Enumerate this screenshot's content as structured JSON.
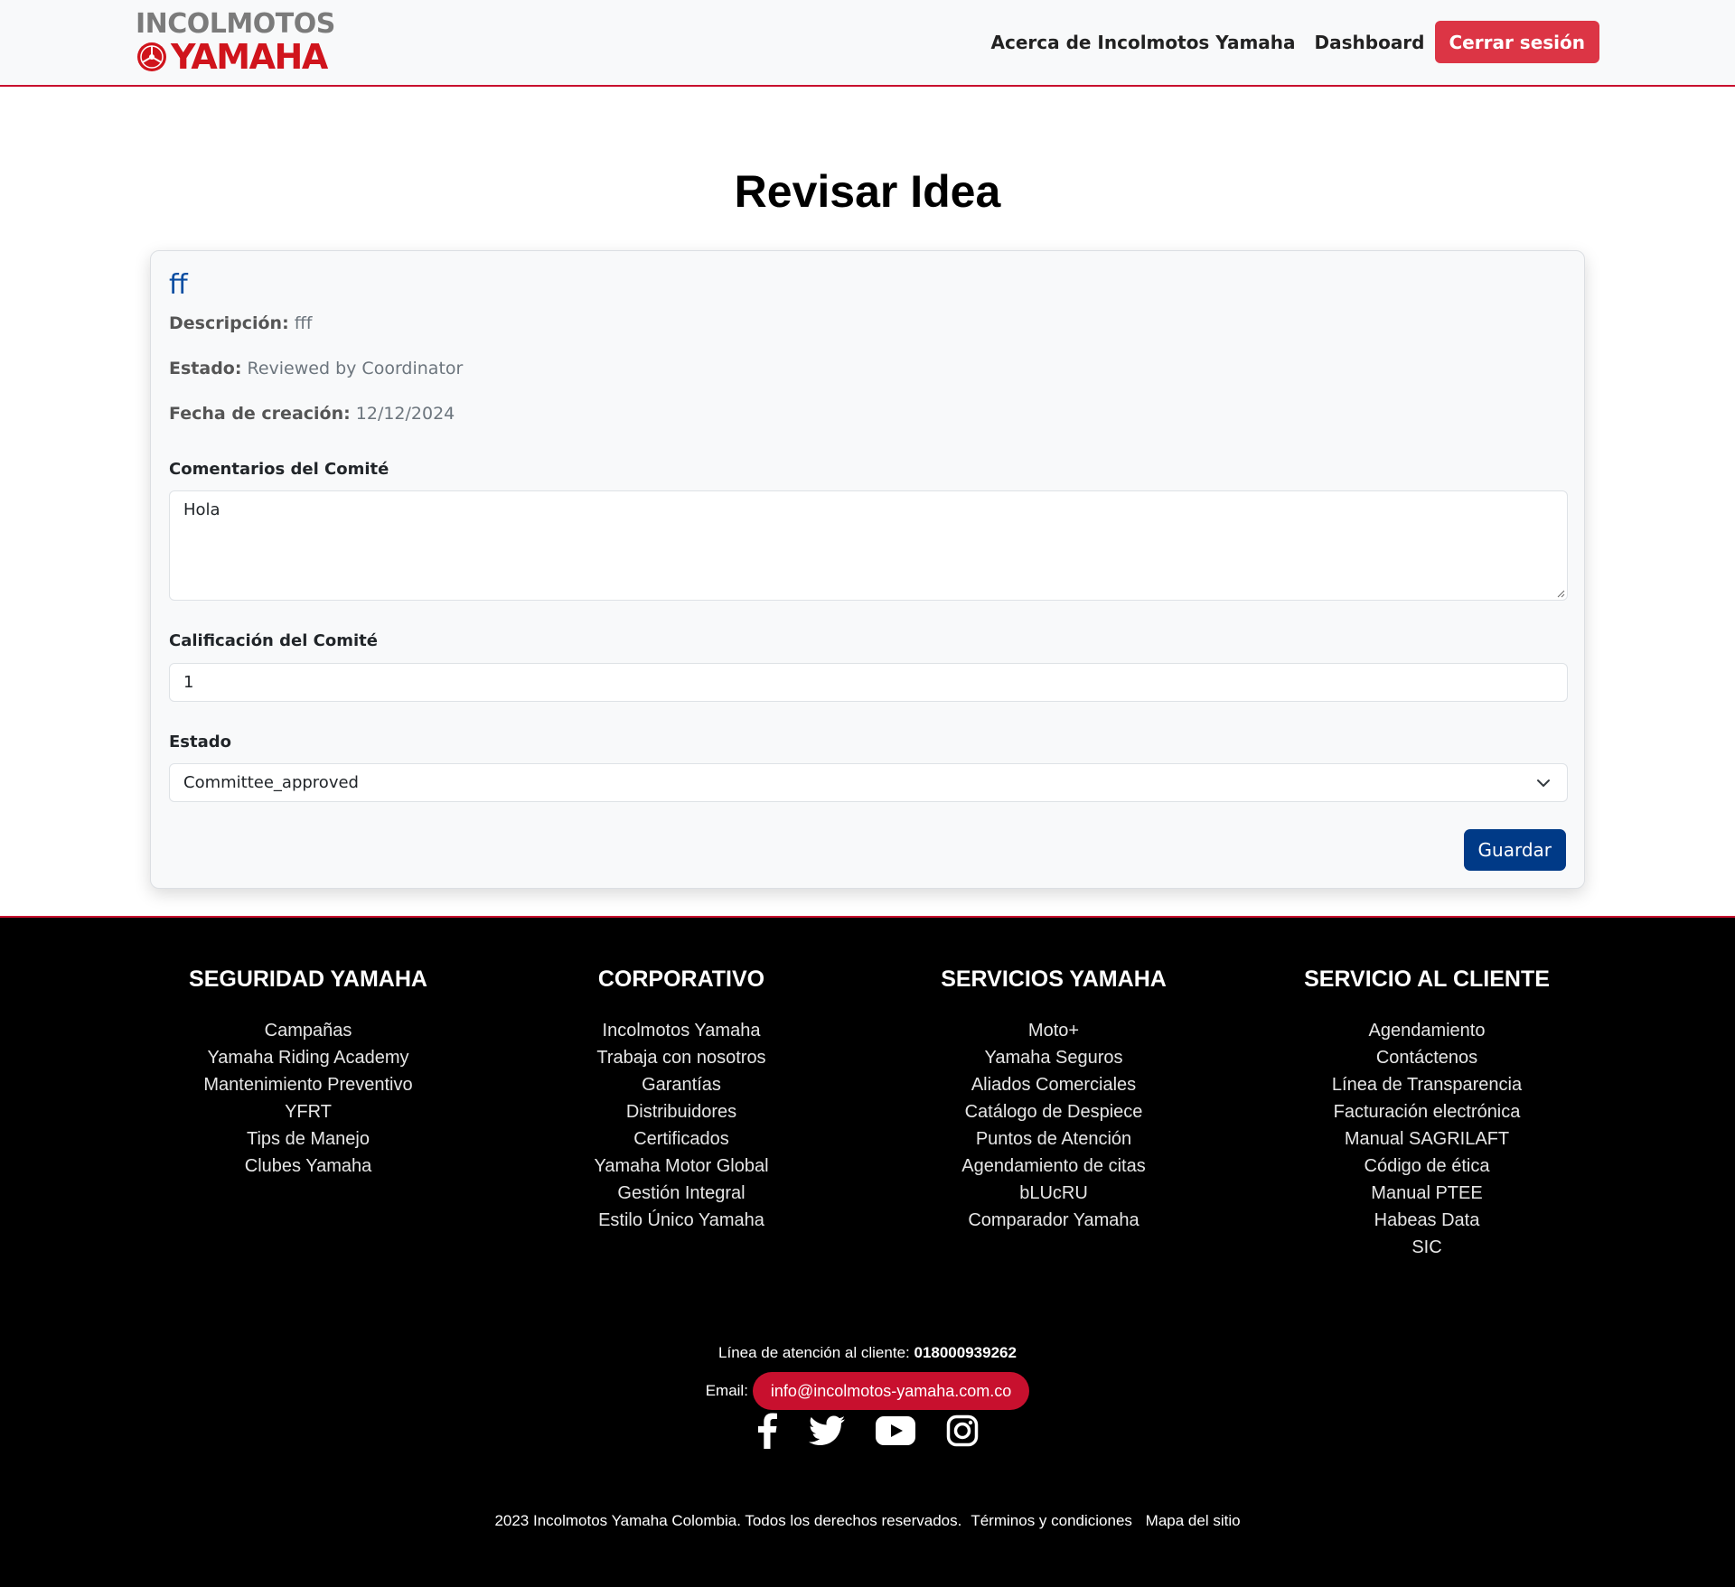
{
  "header": {
    "logo_top": "INCOLMOTOS",
    "logo_bottom": "YAMAHA",
    "nav": [
      "Acerca de Incolmotos Yamaha",
      "Dashboard"
    ],
    "logout": "Cerrar sesión"
  },
  "page": {
    "title": "Revisar Idea"
  },
  "idea": {
    "title": "ff",
    "description_label": "Descripción:",
    "description": "fff",
    "status_label": "Estado:",
    "status": "Reviewed by Coordinator",
    "date_label": "Fecha de creación:",
    "date": "12/12/2024"
  },
  "form": {
    "comments_label": "Comentarios del Comité",
    "comments_value": "Hola",
    "rating_label": "Calificación del Comité",
    "rating_value": "1",
    "state_label": "Estado",
    "state_value": "Committee_approved",
    "save": "Guardar"
  },
  "footer": {
    "columns": [
      {
        "title": "SEGURIDAD YAMAHA",
        "links": [
          "Campañas",
          "Yamaha Riding Academy",
          "Mantenimiento Preventivo",
          "YFRT",
          "Tips de Manejo",
          "Clubes Yamaha"
        ]
      },
      {
        "title": "CORPORATIVO",
        "links": [
          "Incolmotos Yamaha",
          "Trabaja con nosotros",
          "Garantías",
          "Distribuidores",
          "Certificados",
          "Yamaha Motor Global",
          "Gestión Integral",
          "Estilo Único Yamaha"
        ]
      },
      {
        "title": "SERVICIOS YAMAHA",
        "links": [
          "Moto+",
          "Yamaha Seguros",
          "Aliados Comerciales",
          "Catálogo de Despiece",
          "Puntos de Atención",
          "Agendamiento de citas",
          "bLUcRU",
          "Comparador Yamaha"
        ]
      },
      {
        "title": "SERVICIO AL CLIENTE",
        "links": [
          "Agendamiento",
          "Contáctenos",
          "Línea de Transparencia",
          "Facturación electrónica",
          "Manual SAGRILAFT",
          "Código de ética",
          "Manual PTEE",
          "Habeas Data",
          "SIC"
        ]
      }
    ],
    "phone_label": "Línea de atención al cliente:",
    "phone": "018000939262",
    "email_label": "Email:",
    "email": "info@incolmotos-yamaha.com.co",
    "social_icons": [
      "facebook-icon",
      "twitter-icon",
      "youtube-icon",
      "instagram-icon"
    ],
    "copyright": "2023 Incolmotos Yamaha Colombia. Todos los derechos reservados.",
    "terms": "Términos y condiciones",
    "sitemap": "Mapa del sitio"
  },
  "colors": {
    "brand_red": "#c8102e",
    "logout_red": "#dc3545",
    "primary_blue": "#003a87",
    "title_blue": "#0b4ea2"
  }
}
